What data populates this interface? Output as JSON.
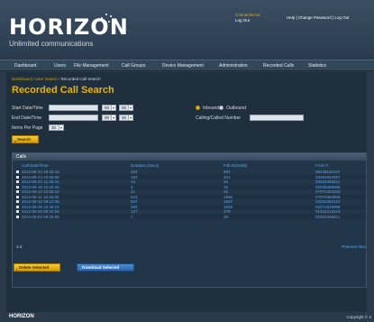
{
  "brand": {
    "logo_text": "HORIZON",
    "tagline": "Unlimited communications",
    "footer_logo": "HORIZON",
    "copyright": "Copyright © 2"
  },
  "user": {
    "name": "Connected as",
    "logout": "Log Out"
  },
  "top_links": "Help | Change Password | Log Out",
  "nav": {
    "items": [
      "Dashboard",
      "Users",
      "File Management",
      "Call Groups",
      "Device Management",
      "Administration",
      "Recorded Calls",
      "Statistics"
    ]
  },
  "breadcrumb": {
    "links": [
      "Dashboard",
      "User Search"
    ],
    "current": "Recorded Call Search"
  },
  "page_title": "Recorded Call Search",
  "form": {
    "start_label": "Start Date/Time",
    "end_label": "End Date/Time",
    "items_label": "Items Per Page",
    "items_value": "30",
    "start_hour": "00",
    "start_min": "00",
    "end_hour": "00",
    "end_min": "00",
    "radio_inbound": "Inbound",
    "radio_outbound": "Outbound",
    "calling_label": "Calling/Called Number",
    "search_button": "Search"
  },
  "calls": {
    "header": "Calls",
    "columns": [
      "Call Date/Time",
      "Duration (Secs)",
      "File Size(KB)",
      "From #"
    ],
    "rows": [
      [
        "2014-06-24 15:45:15",
        "324",
        "993",
        "08448118197"
      ],
      [
        "2014-06-24 10:06:58",
        "163",
        "341",
        "03454684087"
      ],
      [
        "2014-06-23 11:36:42",
        "14",
        "46",
        "03332493611"
      ],
      [
        "2014-06-18 10:28:46",
        "3",
        "16",
        "02038388088"
      ],
      [
        "2014-06-12 10:50:42",
        "21",
        "36",
        "07972462820"
      ],
      [
        "2014-06-11 15:46:30",
        "616",
        "1906",
        "07970384809"
      ],
      [
        "2014-06-10 09:13:48",
        "547",
        "1607",
        "03332493110"
      ],
      [
        "2014-06-09 10:46:21",
        "353",
        "1049",
        "02071629088"
      ],
      [
        "2014-06-03 09:41:08",
        "127",
        "379",
        "01322213333"
      ],
      [
        "2014-06-04 09:26:55",
        "7",
        "26",
        "03332493611"
      ]
    ],
    "pager_info": "1-2",
    "pager_next": "Previous Nex"
  },
  "actions": {
    "delete_label": "Delete Selected",
    "download_label": "Download Selected"
  },
  "colors": {
    "accent": "#e8b400",
    "link": "#5aa6e8",
    "background": "#2a3a4a"
  }
}
